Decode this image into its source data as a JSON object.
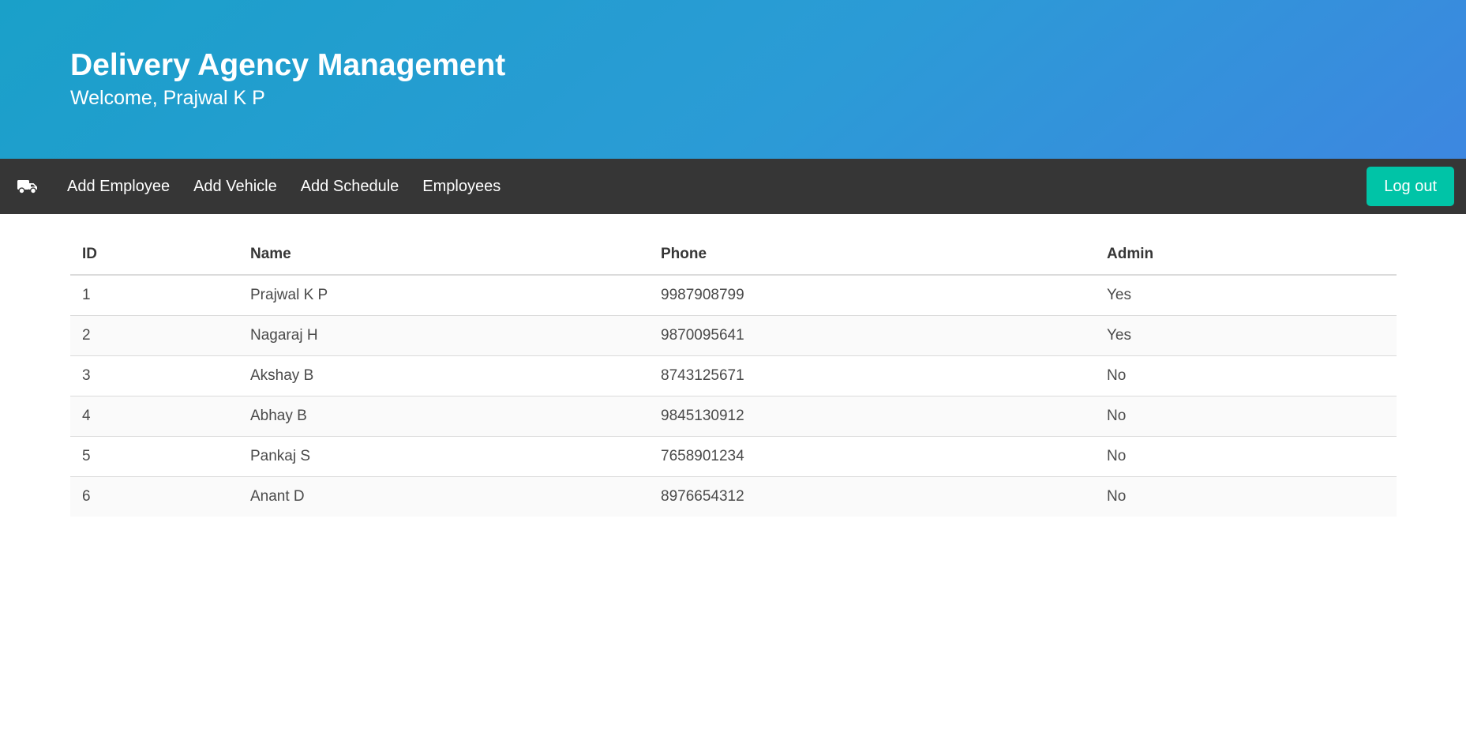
{
  "header": {
    "title": "Delivery Agency Management",
    "subtitle": "Welcome, Prajwal K P"
  },
  "navbar": {
    "brand_icon": "truck-icon",
    "items": [
      {
        "label": "Add Employee"
      },
      {
        "label": "Add Vehicle"
      },
      {
        "label": "Add Schedule"
      },
      {
        "label": "Employees"
      }
    ],
    "logout_label": "Log out"
  },
  "table": {
    "columns": [
      "ID",
      "Name",
      "Phone",
      "Admin"
    ],
    "rows": [
      [
        "1",
        "Prajwal K P",
        "9987908799",
        "Yes"
      ],
      [
        "2",
        "Nagaraj H",
        "9870095641",
        "Yes"
      ],
      [
        "3",
        "Akshay B",
        "8743125671",
        "No"
      ],
      [
        "4",
        "Abhay B",
        "9845130912",
        "No"
      ],
      [
        "5",
        "Pankaj S",
        "7658901234",
        "No"
      ],
      [
        "6",
        "Anant D",
        "8976654312",
        "No"
      ]
    ]
  },
  "colors": {
    "hero_start": "#1aa0c9",
    "hero_end": "#3d87e0",
    "navbar": "#363636",
    "logout_button": "#00c4a7"
  }
}
